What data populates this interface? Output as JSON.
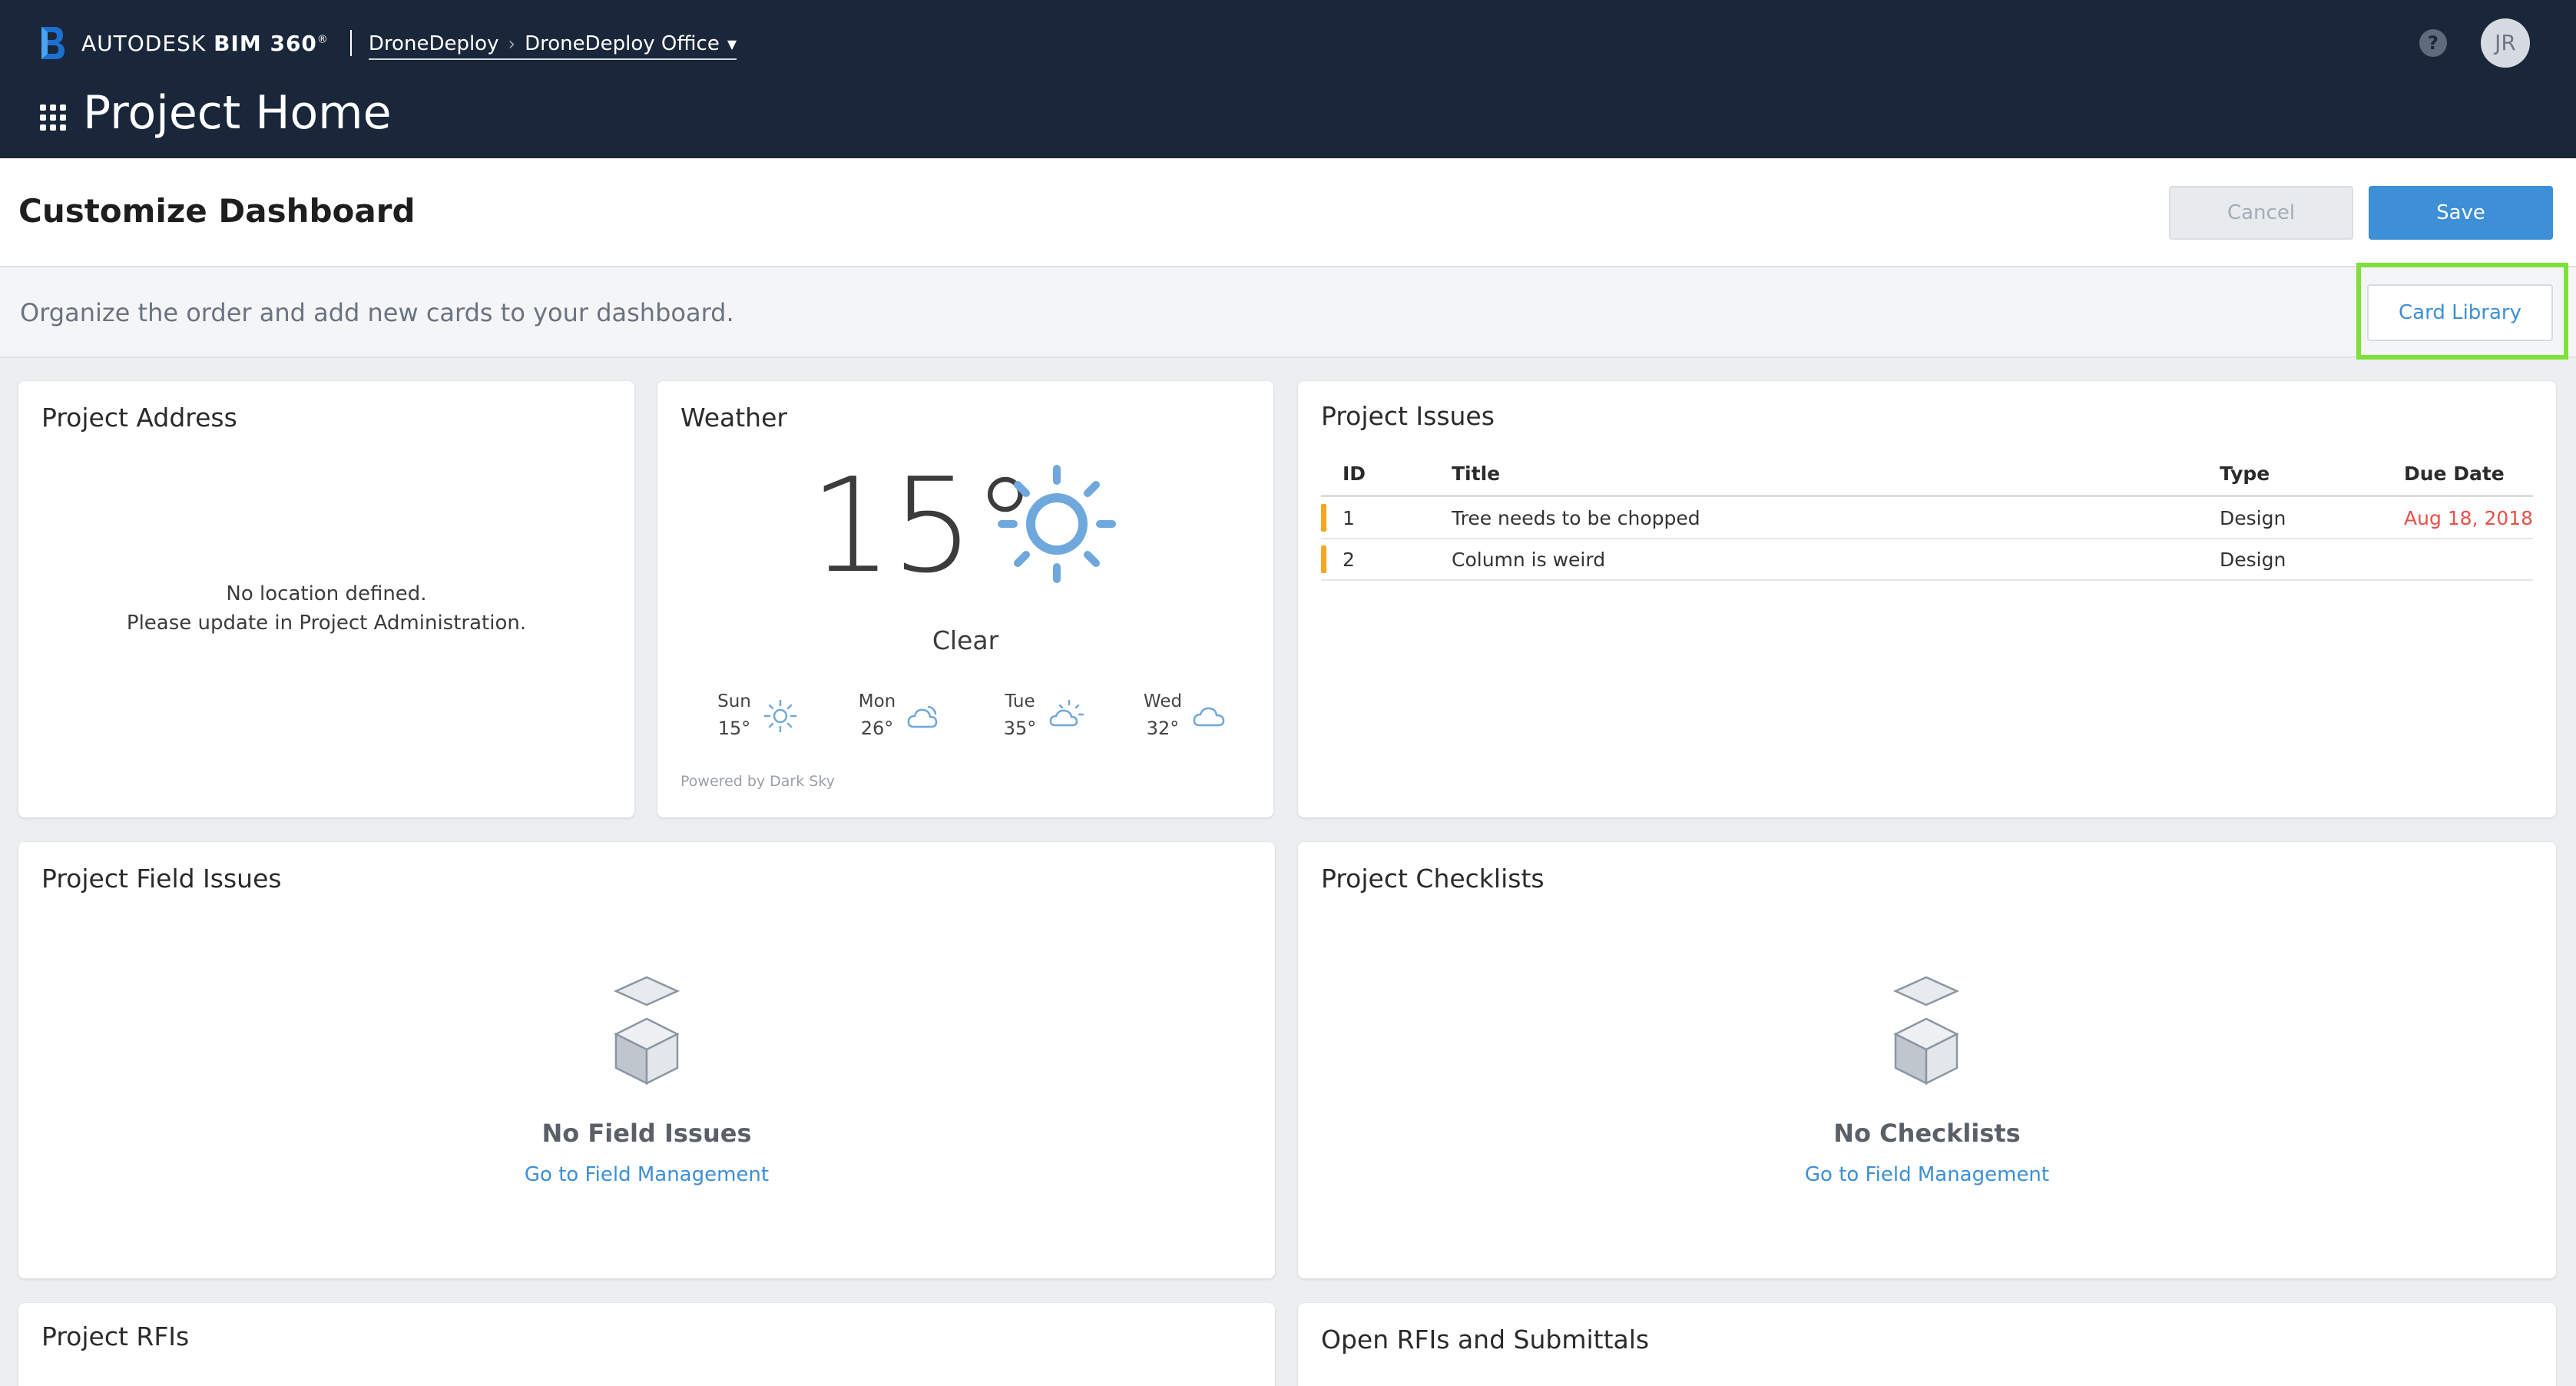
{
  "header": {
    "brand_prefix": "AUTODESK",
    "brand_product": "BIM 360",
    "brand_tm": "®",
    "breadcrumb": [
      "DroneDeploy",
      "DroneDeploy Office"
    ],
    "page_title": "Project Home",
    "help_label": "?",
    "avatar_initials": "JR"
  },
  "customize": {
    "title": "Customize Dashboard",
    "cancel_label": "Cancel",
    "save_label": "Save"
  },
  "instruction": {
    "text": "Organize the order and add new cards to your dashboard.",
    "card_library_label": "Card Library"
  },
  "cards": {
    "address": {
      "title": "Project Address",
      "line1": "No location defined.",
      "line2": "Please update in Project Administration."
    },
    "weather": {
      "title": "Weather",
      "temperature": "15°",
      "condition": "Clear",
      "forecast": [
        {
          "day": "Sun",
          "temp": "15°",
          "icon": "sun-icon"
        },
        {
          "day": "Mon",
          "temp": "26°",
          "icon": "partly-cloudy-icon"
        },
        {
          "day": "Tue",
          "temp": "35°",
          "icon": "partly-sunny-icon"
        },
        {
          "day": "Wed",
          "temp": "32°",
          "icon": "cloud-icon"
        }
      ],
      "powered_by": "Powered by Dark Sky"
    },
    "issues": {
      "title": "Project Issues",
      "columns": [
        "ID",
        "Title",
        "Type",
        "Due Date"
      ],
      "rows": [
        {
          "id": "1",
          "title": "Tree needs to be chopped",
          "type": "Design",
          "due": "Aug 18, 2018"
        },
        {
          "id": "2",
          "title": "Column is weird",
          "type": "Design",
          "due": ""
        }
      ],
      "marker_color": "#f5a623",
      "overdue_color": "#e8504a"
    },
    "field_issues": {
      "title": "Project Field Issues",
      "empty_title": "No Field Issues",
      "link": "Go to Field Management"
    },
    "checklists": {
      "title": "Project Checklists",
      "empty_title": "No Checklists",
      "link": "Go to Field Management"
    },
    "rfis": {
      "title": "Project RFIs"
    },
    "open_rfis": {
      "title": "Open RFIs and Submittals"
    }
  },
  "colors": {
    "header_bg": "#1a2639",
    "accent": "#3d8fd6",
    "highlight": "#7ee03a"
  }
}
